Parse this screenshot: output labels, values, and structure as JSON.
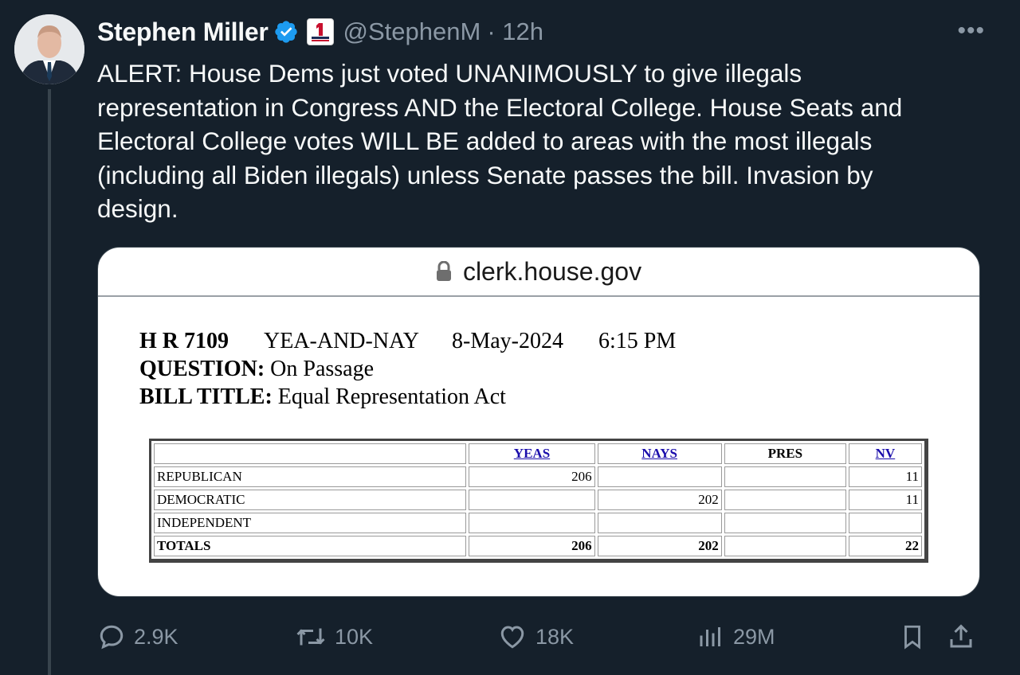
{
  "tweet": {
    "author_name": "Stephen Miller",
    "handle": "@StephenM",
    "time": "· 12h",
    "more_label": "•••",
    "text": "ALERT: House Dems just voted UNANIMOUSLY to give illegals representation in Congress AND the Electoral College. House Seats and Electoral College votes WILL BE added to areas with the most illegals (including all Biden illegals) unless Senate passes the bill. Invasion by design."
  },
  "card": {
    "domain": "clerk.house.gov",
    "bill": "H R 7109",
    "vote_type": "YEA-AND-NAY",
    "date": "8-May-2024",
    "time": "6:15 PM",
    "question_label": "QUESTION:",
    "question": "On Passage",
    "bill_title_label": "BILL TITLE:",
    "bill_title": "Equal Representation Act",
    "table": {
      "headers": [
        "",
        "YEAS",
        "NAYS",
        "PRES",
        "NV"
      ],
      "rows": [
        {
          "party": "REPUBLICAN",
          "yeas": "206",
          "nays": "",
          "pres": "",
          "nv": "11"
        },
        {
          "party": "DEMOCRATIC",
          "yeas": "",
          "nays": "202",
          "pres": "",
          "nv": "11"
        },
        {
          "party": "INDEPENDENT",
          "yeas": "",
          "nays": "",
          "pres": "",
          "nv": ""
        },
        {
          "party": "TOTALS",
          "yeas": "206",
          "nays": "202",
          "pres": "",
          "nv": "22"
        }
      ]
    }
  },
  "actions": {
    "replies": "2.9K",
    "retweets": "10K",
    "likes": "18K",
    "views": "29M"
  },
  "colors": {
    "background": "#15202b",
    "verified": "#1d9bf0",
    "muted": "#8b98a5"
  }
}
